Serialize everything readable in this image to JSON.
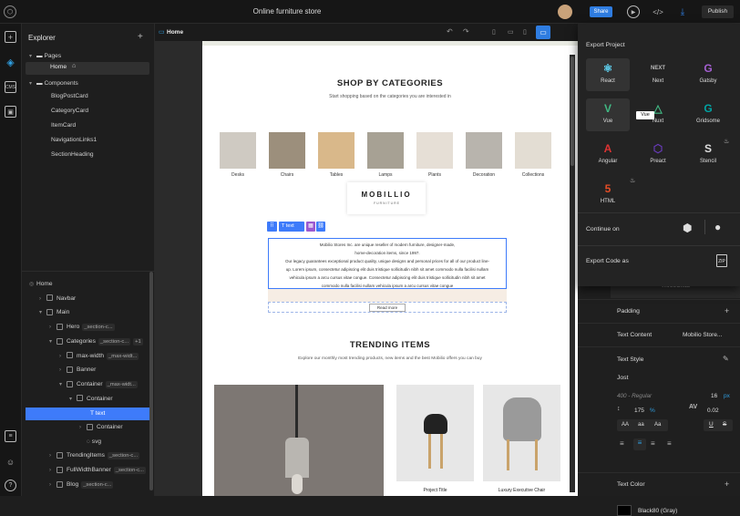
{
  "topbar": {
    "title": "Online furniture store",
    "share_label": "Share",
    "publish_label": "Publish"
  },
  "explorer": {
    "title": "Explorer",
    "pages_label": "Pages",
    "home_page": "Home",
    "components_label": "Components",
    "components": [
      "BlogPostCard",
      "CategoryCard",
      "ItemCard",
      "NavigationLinks1",
      "SectionHeading"
    ]
  },
  "layers": [
    {
      "label": "Home",
      "tag": "",
      "indent": 0
    },
    {
      "label": "Navbar",
      "tag": "",
      "indent": 1
    },
    {
      "label": "Main",
      "tag": "",
      "indent": 1
    },
    {
      "label": "Hero",
      "tag": "_section-c...",
      "indent": 2
    },
    {
      "label": "Categories",
      "tag": "_section-c...",
      "extra": "+1",
      "indent": 2
    },
    {
      "label": "max-width",
      "tag": "_max-widt...",
      "indent": 3
    },
    {
      "label": "Banner",
      "tag": "",
      "indent": 3
    },
    {
      "label": "Container",
      "tag": "_max-widt...",
      "indent": 3
    },
    {
      "label": "Container",
      "tag": "",
      "indent": 4
    },
    {
      "label": "text",
      "tag": "",
      "indent": 5
    },
    {
      "label": "Container",
      "tag": "",
      "indent": 5
    },
    {
      "label": "svg",
      "tag": "",
      "indent": 5
    },
    {
      "label": "TrendingItems",
      "tag": "_section-c...",
      "indent": 2
    },
    {
      "label": "FullWidthBanner",
      "tag": "_section-c...",
      "indent": 2
    },
    {
      "label": "Blog",
      "tag": "_section-c...",
      "indent": 2
    }
  ],
  "canvas": {
    "tab_label": "Home",
    "shop_title": "SHOP BY CATEGORIES",
    "shop_subtitle": "Start shopping based on the categories you are interested in",
    "categories": [
      "Desks",
      "Chairs",
      "Tables",
      "Lamps",
      "Plants",
      "Decoration",
      "Collections"
    ],
    "logo_main": "MOBILLIO",
    "logo_sub": "F U R N I T U R E",
    "toolbar_text_label": "text",
    "about_lines": [
      "Mobilio Stores Inc. are unique reseller of modern furniture, designer-made,",
      "home-decoration items, since 1997.",
      "Our legacy guarantees exceptional product quality, unique designs and personal prices for all of our product line-",
      "up. Lorem ipsum, consectetur adipiscing elit duis tristique sollicitudin nibh sit amet commodo nulla facilisi nullam",
      "vehicula ipsum a arcu cursus vitae congue. Consectetur adipiscing elit duis tristique sollicitudin nibh sit amet",
      "commodo nulla facilisi nullam vehicula ipsum a arcu cursus vitae congue"
    ],
    "read_more_label": "Read more",
    "trending_title": "TRENDING ITEMS",
    "trending_subtitle": "Explore our monthly most trending products, new items and the best Mobilio offers you can buy",
    "product_1": "Project Title",
    "product_2": "Luxury Executive Chair"
  },
  "export": {
    "title": "Export Project",
    "frameworks": [
      "React",
      "Next",
      "Gatsby",
      "Vue",
      "Nuxt",
      "Gridsome",
      "Angular",
      "Preact",
      "Stencil",
      "HTML"
    ],
    "tooltip": "Vue",
    "continue_label": "Continue on",
    "export_code_label": "Export Code as"
  },
  "props": {
    "three_units": "ThreeUnits",
    "padding_label": "Padding",
    "text_content_label": "Text Content",
    "text_content_value": "Mobilio Store...",
    "text_style_label": "Text Style",
    "font_name": "Jost",
    "font_weight": "400 - Regular",
    "font_size": "16",
    "font_unit": "px",
    "line_height": "175",
    "line_height_unit": "%",
    "letter_spacing": "0.02",
    "case_upper": "AA",
    "case_lower": "aa",
    "case_title": "Aa",
    "underline": "U",
    "strike": "S",
    "text_color_label": "Text Color",
    "text_color_value": "Black80 (Gray)"
  },
  "colors": {
    "accent": "#2f7de1",
    "selection": "#3e7bfa",
    "purple": "#9b59d0"
  }
}
